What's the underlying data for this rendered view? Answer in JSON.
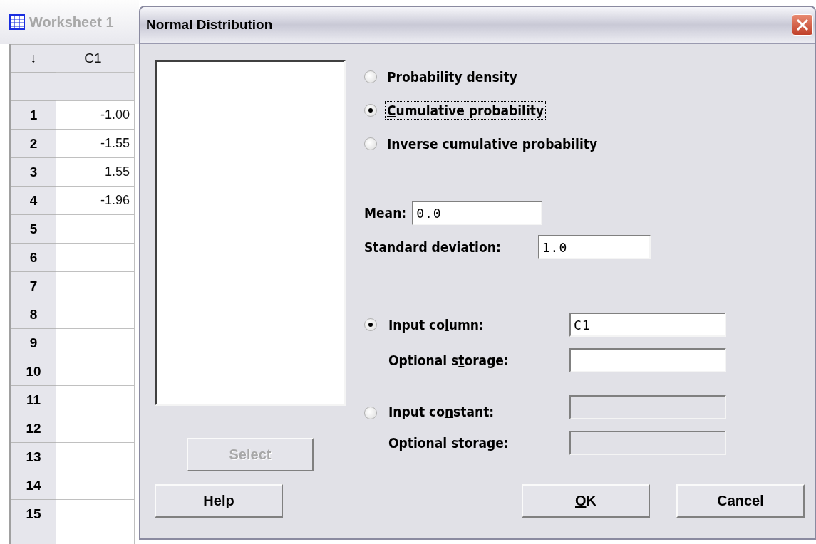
{
  "worksheet": {
    "title": "Worksheet 1",
    "active": false,
    "corner": "↓",
    "columns": [
      "C1"
    ],
    "rows": [
      {
        "number": "1",
        "values": [
          "-1.00"
        ]
      },
      {
        "number": "2",
        "values": [
          "-1.55"
        ]
      },
      {
        "number": "3",
        "values": [
          "1.55"
        ]
      },
      {
        "number": "4",
        "values": [
          "-1.96"
        ]
      },
      {
        "number": "5",
        "values": []
      },
      {
        "number": "6",
        "values": []
      },
      {
        "number": "7",
        "values": []
      },
      {
        "number": "8",
        "values": []
      },
      {
        "number": "9",
        "values": []
      },
      {
        "number": "10",
        "values": []
      },
      {
        "number": "11",
        "values": []
      },
      {
        "number": "12",
        "values": []
      },
      {
        "number": "13",
        "values": []
      },
      {
        "number": "14",
        "values": []
      },
      {
        "number": "15",
        "values": []
      }
    ]
  },
  "dialog": {
    "title": "Normal Distribution",
    "select_button": {
      "label": {
        "text": "Select"
      },
      "disabled": true
    },
    "options": [
      {
        "label": {
          "key": "P",
          "after": "robability density"
        },
        "selected": false,
        "focused": false
      },
      {
        "label": {
          "key": "C",
          "after": "umulative probability"
        },
        "selected": true,
        "focused": true
      },
      {
        "label": {
          "key": "I",
          "after": "nverse cumulative probability"
        },
        "selected": false,
        "focused": false
      }
    ],
    "mean": {
      "label": {
        "key": "M",
        "after": "ean:"
      },
      "value": "0.0"
    },
    "std_dev": {
      "label": {
        "key": "S",
        "after": "tandard deviation:"
      },
      "value": "1.0"
    },
    "inputs": [
      {
        "kind": "radio",
        "label": {
          "before": "Input co",
          "key": "l",
          "after": "umn:"
        },
        "selected": true,
        "disabled": false,
        "value": "C1"
      },
      {
        "kind": "plain",
        "label": {
          "before": "Optional s",
          "key": "t",
          "after": "orage:"
        },
        "disabled": false
      },
      {
        "kind": "radio",
        "label": {
          "before": "Input co",
          "key": "n",
          "after": "stant:"
        },
        "selected": false,
        "disabled": true
      },
      {
        "kind": "plain",
        "label": {
          "before": "Optional sto",
          "key": "r",
          "after": "age:"
        },
        "disabled": true
      }
    ],
    "buttons": [
      {
        "label": {
          "text": "Help"
        }
      },
      {
        "label": {
          "key": "O",
          "after": "K"
        }
      },
      {
        "label": {
          "text": "Cancel"
        }
      }
    ]
  }
}
